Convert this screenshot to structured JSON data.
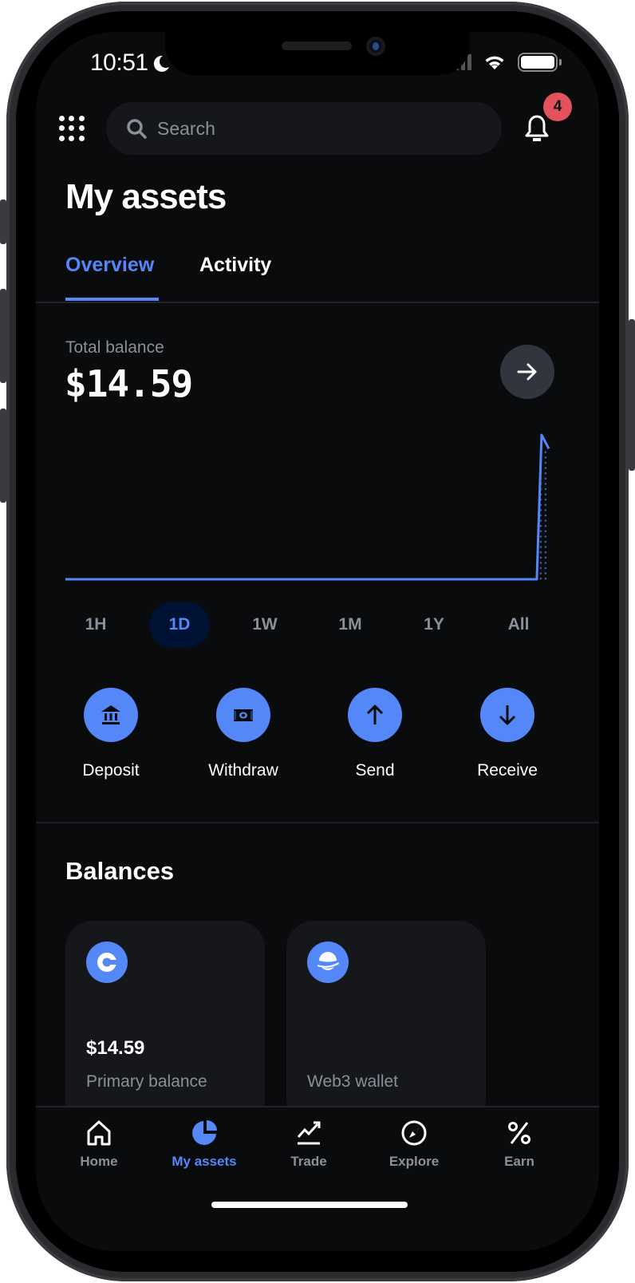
{
  "status_bar": {
    "time": "10:51",
    "focus_icon": "moon-icon",
    "signal_icon": "cellular-signal-icon",
    "wifi_icon": "wifi-icon",
    "battery_icon": "battery-icon"
  },
  "header": {
    "menu_icon": "grid-menu-icon",
    "search_placeholder": "Search",
    "notification_count": "4"
  },
  "page": {
    "title": "My assets"
  },
  "tabs": [
    {
      "label": "Overview",
      "active": true
    },
    {
      "label": "Activity",
      "active": false
    }
  ],
  "balance": {
    "label": "Total balance",
    "value": "$14.59"
  },
  "chart_data": {
    "type": "line",
    "title": "",
    "xlabel": "",
    "ylabel": "",
    "range": "1D",
    "x": [
      0,
      0.1,
      0.2,
      0.3,
      0.4,
      0.5,
      0.6,
      0.7,
      0.8,
      0.9,
      0.975,
      0.985,
      1.0
    ],
    "values": [
      0,
      0,
      0,
      0,
      0,
      0,
      0,
      0,
      0,
      0,
      0,
      14.59,
      13.2
    ],
    "ylim": [
      0,
      15
    ],
    "color": "#5488f8",
    "grid": false
  },
  "time_ranges": [
    {
      "label": "1H",
      "active": false
    },
    {
      "label": "1D",
      "active": true
    },
    {
      "label": "1W",
      "active": false
    },
    {
      "label": "1M",
      "active": false
    },
    {
      "label": "1Y",
      "active": false
    },
    {
      "label": "All",
      "active": false
    }
  ],
  "actions": [
    {
      "label": "Deposit",
      "icon": "bank-icon"
    },
    {
      "label": "Withdraw",
      "icon": "cash-icon"
    },
    {
      "label": "Send",
      "icon": "arrow-up-icon"
    },
    {
      "label": "Receive",
      "icon": "arrow-down-icon"
    }
  ],
  "balances": {
    "title": "Balances",
    "cards": [
      {
        "value": "$14.59",
        "label": "Primary balance",
        "icon": "coinbase-icon"
      },
      {
        "value": "",
        "label": "Web3 wallet",
        "icon": "planet-icon"
      }
    ]
  },
  "nav": [
    {
      "label": "Home",
      "icon": "home-icon",
      "active": false
    },
    {
      "label": "My assets",
      "icon": "pie-chart-icon",
      "active": true
    },
    {
      "label": "Trade",
      "icon": "trend-icon",
      "active": false
    },
    {
      "label": "Explore",
      "icon": "compass-icon",
      "active": false
    },
    {
      "label": "Earn",
      "icon": "percent-icon",
      "active": false
    }
  ],
  "colors": {
    "accent": "#5488f8",
    "badge": "#e4525d",
    "background": "#0a0b0d",
    "card": "#16171b"
  }
}
